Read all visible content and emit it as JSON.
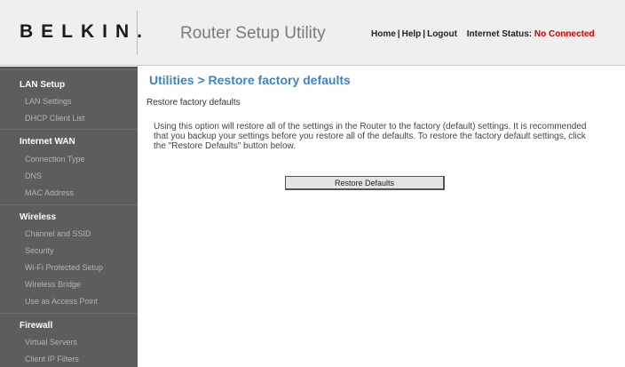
{
  "header": {
    "logo": "BELKIN.",
    "app_title": "Router Setup Utility",
    "links": {
      "home": "Home",
      "help": "Help",
      "logout": "Logout",
      "sep": "|"
    },
    "internet_status_label": "Internet Status:",
    "internet_status_value": "No Connected"
  },
  "sidebar": {
    "sections": [
      {
        "title": "LAN Setup",
        "items": [
          "LAN Settings",
          "DHCP Client List"
        ]
      },
      {
        "title": "Internet WAN",
        "items": [
          "Connection Type",
          "DNS",
          "MAC Address"
        ]
      },
      {
        "title": "Wireless",
        "items": [
          "Channel and SSID",
          "Security",
          "Wi-Fi Protected Setup",
          "Wireless Bridge",
          "Use as Access Point"
        ]
      },
      {
        "title": "Firewall",
        "items": [
          "Virtual Servers",
          "Client IP Filters"
        ]
      }
    ]
  },
  "main": {
    "page_title": "Utilities > Restore factory defaults",
    "subheading": "Restore factory defaults",
    "description": "Using this option will restore all of the settings in the Router to the factory (default) settings. It is recommended that you backup your settings before you restore all of the defaults. To restore the factory default settings, click the \"Restore Defaults\" button below.",
    "restore_button": "Restore Defaults"
  },
  "colors": {
    "title_blue": "#3c84c4",
    "status_red": "#cc0000",
    "sidebar_bg": "#5d5d5d"
  }
}
